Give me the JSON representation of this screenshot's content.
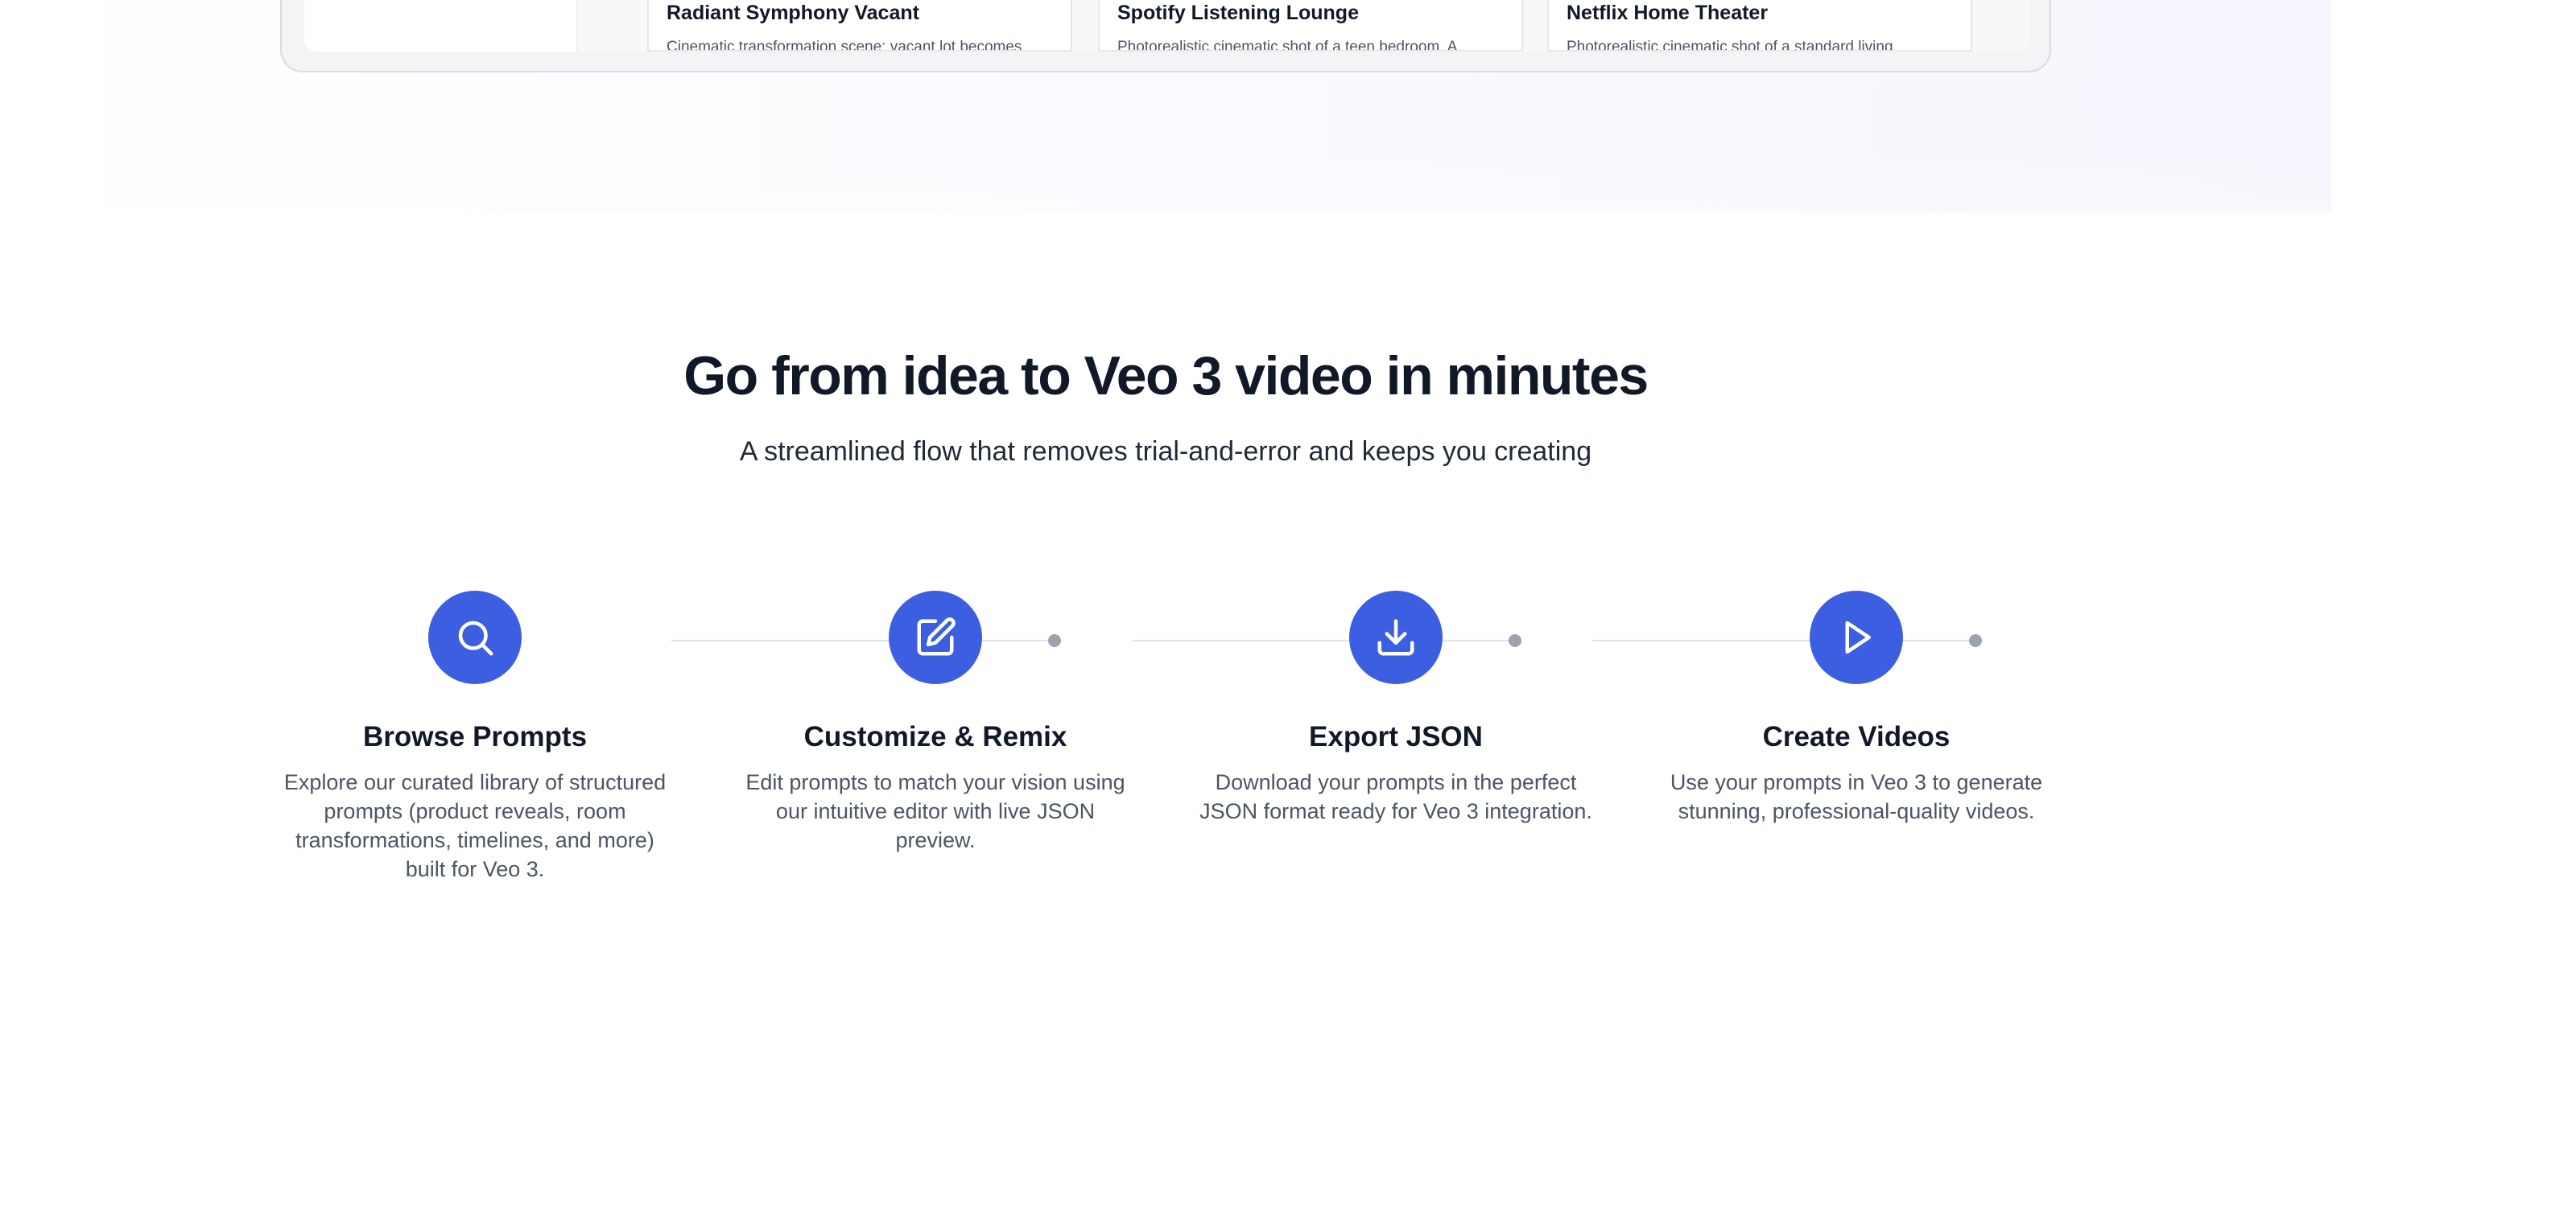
{
  "showcase": {
    "cards": [
      {
        "title": "Radiant Symphony Vacant",
        "description": "Cinematic transformation scene: vacant lot becomes"
      },
      {
        "title": "Spotify Listening Lounge",
        "description": "Photorealistic cinematic shot of a teen bedroom. A"
      },
      {
        "title": "Netflix Home Theater",
        "description": "Photorealistic cinematic shot of a standard living"
      }
    ]
  },
  "how_it_works": {
    "heading": "Go from idea to Veo 3 video in minutes",
    "subheading": "A streamlined flow that removes trial-and-error and keeps you creating",
    "steps": [
      {
        "icon": "search-icon",
        "title": "Browse Prompts",
        "description": "Explore our curated library of structured prompts (product reveals, room transformations, timelines, and more) built for Veo 3."
      },
      {
        "icon": "edit-icon",
        "title": "Customize & Remix",
        "description": "Edit prompts to match your vision using our intuitive editor with live JSON preview."
      },
      {
        "icon": "download-icon",
        "title": "Export JSON",
        "description": "Download your prompts in the perfect JSON format ready for Veo 3 integration."
      },
      {
        "icon": "play-icon",
        "title": "Create Videos",
        "description": "Use your prompts in Veo 3 to generate stunning, professional-quality videos."
      }
    ]
  },
  "colors": {
    "accent": "#3b5fe0",
    "heading": "#111827",
    "body_text": "#4b5563",
    "connector": "#e2e4ea",
    "connector_dot": "#9ca3af"
  }
}
